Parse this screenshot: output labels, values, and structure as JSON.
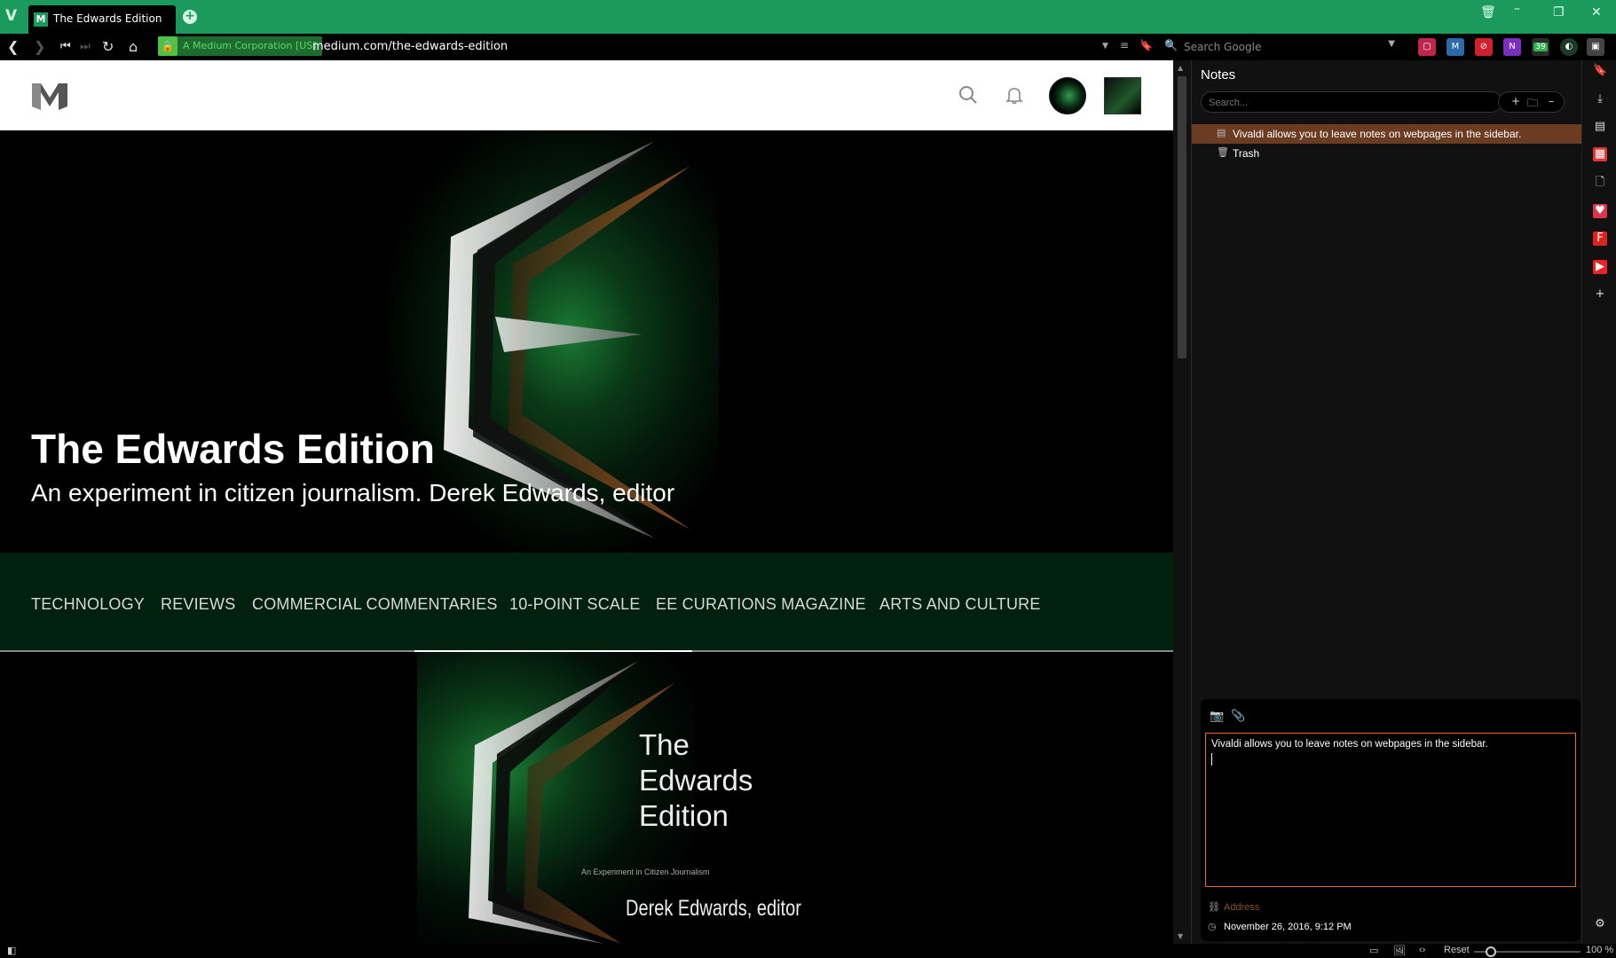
{
  "browser": {
    "tab_title": "The Edwards Edition",
    "cert_label": "A Medium Corporation [US]",
    "url": "medium.com/the-edwards-edition",
    "search_placeholder": "Search Google",
    "extension_badge_count": "39"
  },
  "page": {
    "publication_title": "The Edwards Edition",
    "publication_subtitle": "An experiment in citizen journalism. Derek Edwards, editor",
    "nav_items": [
      "TECHNOLOGY",
      "REVIEWS",
      "COMMERCIAL COMMENTARIES",
      "10-POINT SCALE",
      "EE CURATIONS MAGAZINE",
      "ARTS AND CULTURE"
    ],
    "cover": {
      "title_lines": [
        "The",
        "Edwards",
        "Edition"
      ],
      "tagline": "An Experiment in Citizen Journalism",
      "editor_line": "Derek Edwards, editor"
    }
  },
  "notes_panel": {
    "title": "Notes",
    "search_placeholder": "Search...",
    "items": [
      {
        "label": "Vivaldi allows you to leave notes on webpages in the sidebar.",
        "selected": true
      },
      {
        "label": "Trash",
        "selected": false
      }
    ],
    "editor_text": "Vivaldi allows you to leave notes on webpages in the sidebar.",
    "address_placeholder": "Address",
    "date": "November 26, 2016, 9:12 PM"
  },
  "statusbar": {
    "reset_label": "Reset",
    "zoom_value": "100 %"
  },
  "colors": {
    "tabstrip": "#1a9a5c",
    "nav_band": "#02200e",
    "note_selected": "#6b3b22",
    "editor_border": "#e86a2a"
  }
}
